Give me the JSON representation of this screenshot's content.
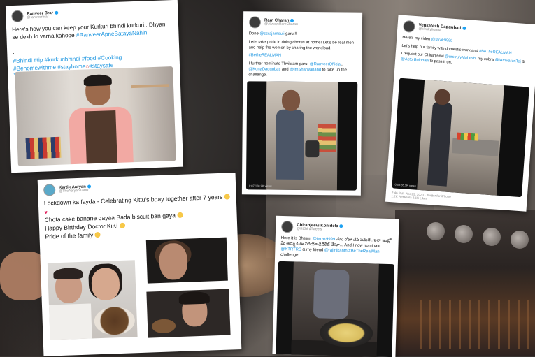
{
  "cards": {
    "ranveer": {
      "name": "Ranveer Brar",
      "handle": "@ranveerbrar",
      "text1": "Here's how you can keep your Kurkuri bhindi kurkuri.. Dhyan se dekh lo varna kahoge",
      "hashtag1": "#RanveerApneBatayaNahin",
      "dots": ".\n.",
      "hashtags_line1": "#Bhindi #tip #kurkuribhindi #food #Cooking",
      "hashtags_line2": "#Behomewithme #stayhome",
      "hashtags_line2b": "#staysafe",
      "translate": "Translate Tweet"
    },
    "ram": {
      "name": "Ram Charan",
      "handle": "@AlwaysRamCharan",
      "line1_prefix": "Done",
      "line1_mention": "@ssrajamouli",
      "line1_suffix": "garu !!",
      "line2": "Let's take pride in doing chores at home! Let's be real men and help the women by sharing the work load.",
      "hashtag": "#BetheREALMAN",
      "line3_prefix": "I further nominate Thvikram garu,",
      "line3_mention1": "@RanveerOfficial",
      "line3_mention2": "@KonaDaggubati",
      "line3_mid": "and",
      "line3_mention3": "@ImSharwanand",
      "line3_suffix": "to take up the challenge.",
      "vid_time": "0:07   168.9K views"
    },
    "mahesh": {
      "name": "Venkatesh Daggubati",
      "handle": "@VenkyMama",
      "line1_prefix": "Here's my video",
      "line1_mention": "@tarak9999",
      "line2": "Let's help our family with domestic work and",
      "hashtag": "#BeTheREALMAN",
      "line3_prefix": "I request our Chiranjeevi",
      "line3_mention1": "@urstrulyMahesh",
      "line3_mid": ", my cobra",
      "line3_mention2": "@IAmVarunTej",
      "line3_mid2": "&",
      "line3_mention3": "@ActorBoinpalli",
      "line3_suffix": "to pass it on.",
      "vid_time": "0:08   85.5K views",
      "footer": "7:46 PM · Apr 23, 2020 · Twitter for iPhone",
      "footer2": "1.2K Retweets   8.1K Likes"
    },
    "kartik": {
      "name": "Kartik Aaryan",
      "handle": "@TheAaryanKartik",
      "line1": "Lockdown ka fayda - Celebrating Kittu's bday together after 7 years",
      "line2": "Chota cake banane gayaa Bada biscuit ban gaya",
      "line3": "Happy Birthday Doctor KiKi",
      "line4": "Pride of the family"
    },
    "chiru": {
      "name": "Chiranjeevi Konidela",
      "handle": "@KChiruTweets",
      "line1_prefix": "Here it is Bheem",
      "line1_mention": "@tarak9999",
      "line1_telugu": "నేను రోజు చేసే పనులే.. ఇలా ఇంట్లో మీ అమ్మ కి ఈ వీడియో డెడికేట్ చేస్తూ..",
      "line1_suffix": ". And I now nominate",
      "line2_mention1": "@KTRTRS",
      "line2_mid": "& my friend",
      "line2_mention2": "@rajinikanth",
      "hashtag": "#BeTheRealMan",
      "line2_suffix": "challenge."
    }
  }
}
